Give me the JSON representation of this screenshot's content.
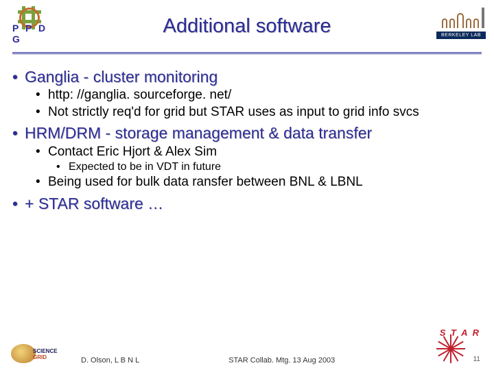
{
  "header": {
    "title": "Additional software",
    "left_logo_label": "P P D G",
    "right_logo_label": "BERKELEY LAB"
  },
  "bullets": [
    {
      "text": "Ganglia - cluster monitoring",
      "children": [
        {
          "text": "http: //ganglia. sourceforge. net/"
        },
        {
          "text": "Not strictly req'd for grid but STAR uses as input to grid info svcs"
        }
      ]
    },
    {
      "text": "HRM/DRM - storage management & data transfer",
      "children": [
        {
          "text": "Contact Eric Hjort & Alex Sim",
          "children": [
            {
              "text": "Expected to be in VDT in future"
            }
          ]
        },
        {
          "text": "Being used for bulk data ransfer between BNL & LBNL"
        }
      ]
    },
    {
      "text": "+ STAR software …"
    }
  ],
  "footer": {
    "author": "D. Olson,  L B N L",
    "event": "STAR Collab. Mtg. 13 Aug 2003",
    "star": "S T A R",
    "page": "11",
    "scigrid_a": "SCIENCE",
    "scigrid_b": "GRID"
  }
}
